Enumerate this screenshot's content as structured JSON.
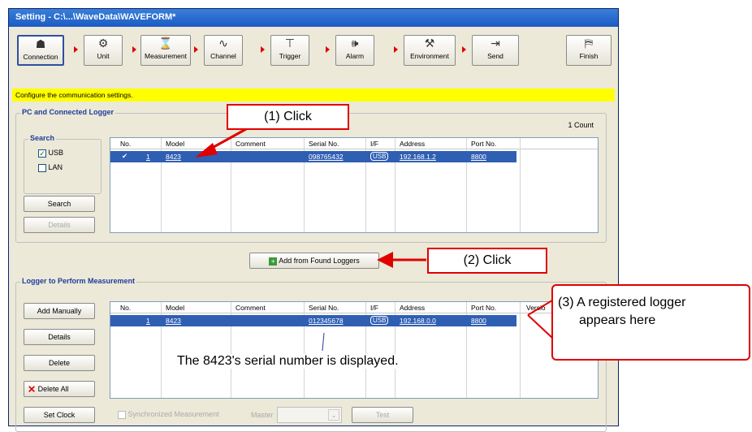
{
  "window": {
    "title": "Setting - C:\\...\\WaveData\\WAVEFORM*"
  },
  "toolbar": {
    "steps": [
      {
        "label": "Connection",
        "icon": "network-icon"
      },
      {
        "label": "Unit",
        "icon": "unit-icon"
      },
      {
        "label": "Measurement",
        "icon": "hourglass-icon"
      },
      {
        "label": "Channel",
        "icon": "waveform-icon"
      },
      {
        "label": "Trigger",
        "icon": "trigger-icon"
      },
      {
        "label": "Alarm",
        "icon": "speaker-icon"
      },
      {
        "label": "Environment",
        "icon": "tools-icon"
      },
      {
        "label": "Send",
        "icon": "send-icon"
      },
      {
        "label": "Finish",
        "icon": "door-icon"
      }
    ]
  },
  "info_bar": {
    "text": "Configure the communication settings."
  },
  "pc_section": {
    "title": "PC and Connected Logger",
    "count": "1 Count",
    "search_group": {
      "title": "Search",
      "usb_label": "USB",
      "usb_checked": true,
      "lan_label": "LAN",
      "lan_checked": false
    },
    "search_button": "Search",
    "details_button": "Details",
    "columns": [
      "No.",
      "Model",
      "Comment",
      "Serial No.",
      "I/F",
      "Address",
      "Port No."
    ],
    "rows": [
      {
        "no": "1",
        "model": "8423",
        "comment": "",
        "serial": "098765432",
        "if": "USB",
        "address": "192.168.1.2",
        "port": "8800"
      }
    ]
  },
  "add_button": {
    "label": "Add from Found Loggers"
  },
  "logger_section": {
    "title": "Logger to Perform Measurement",
    "add_manually": "Add Manually",
    "details": "Details",
    "delete": "Delete",
    "delete_all": "Delete All",
    "set_clock": "Set Clock",
    "sync_label": "Synchronized Measurement",
    "master_label": "Master",
    "test_label": "Test",
    "columns": [
      "No.",
      "Model",
      "Comment",
      "Serial No.",
      "I/F",
      "Address",
      "Port No.",
      "Versio"
    ],
    "rows": [
      {
        "no": "1",
        "model": "8423",
        "comment": "",
        "serial": "012345678",
        "if": "USB",
        "address": "192.168.0.0",
        "port": "8800"
      }
    ]
  },
  "annotations": {
    "click1": "(1) Click",
    "click2": "(2) Click",
    "click3_line1": "(3) A registered logger",
    "click3_line2": "appears here",
    "serial_note": "The 8423's serial number is displayed."
  },
  "colors": {
    "accent_red": "#e00000",
    "selection": "#2f5fb3",
    "info_yellow": "#ffff00",
    "legend_blue": "#1f3c9b"
  }
}
